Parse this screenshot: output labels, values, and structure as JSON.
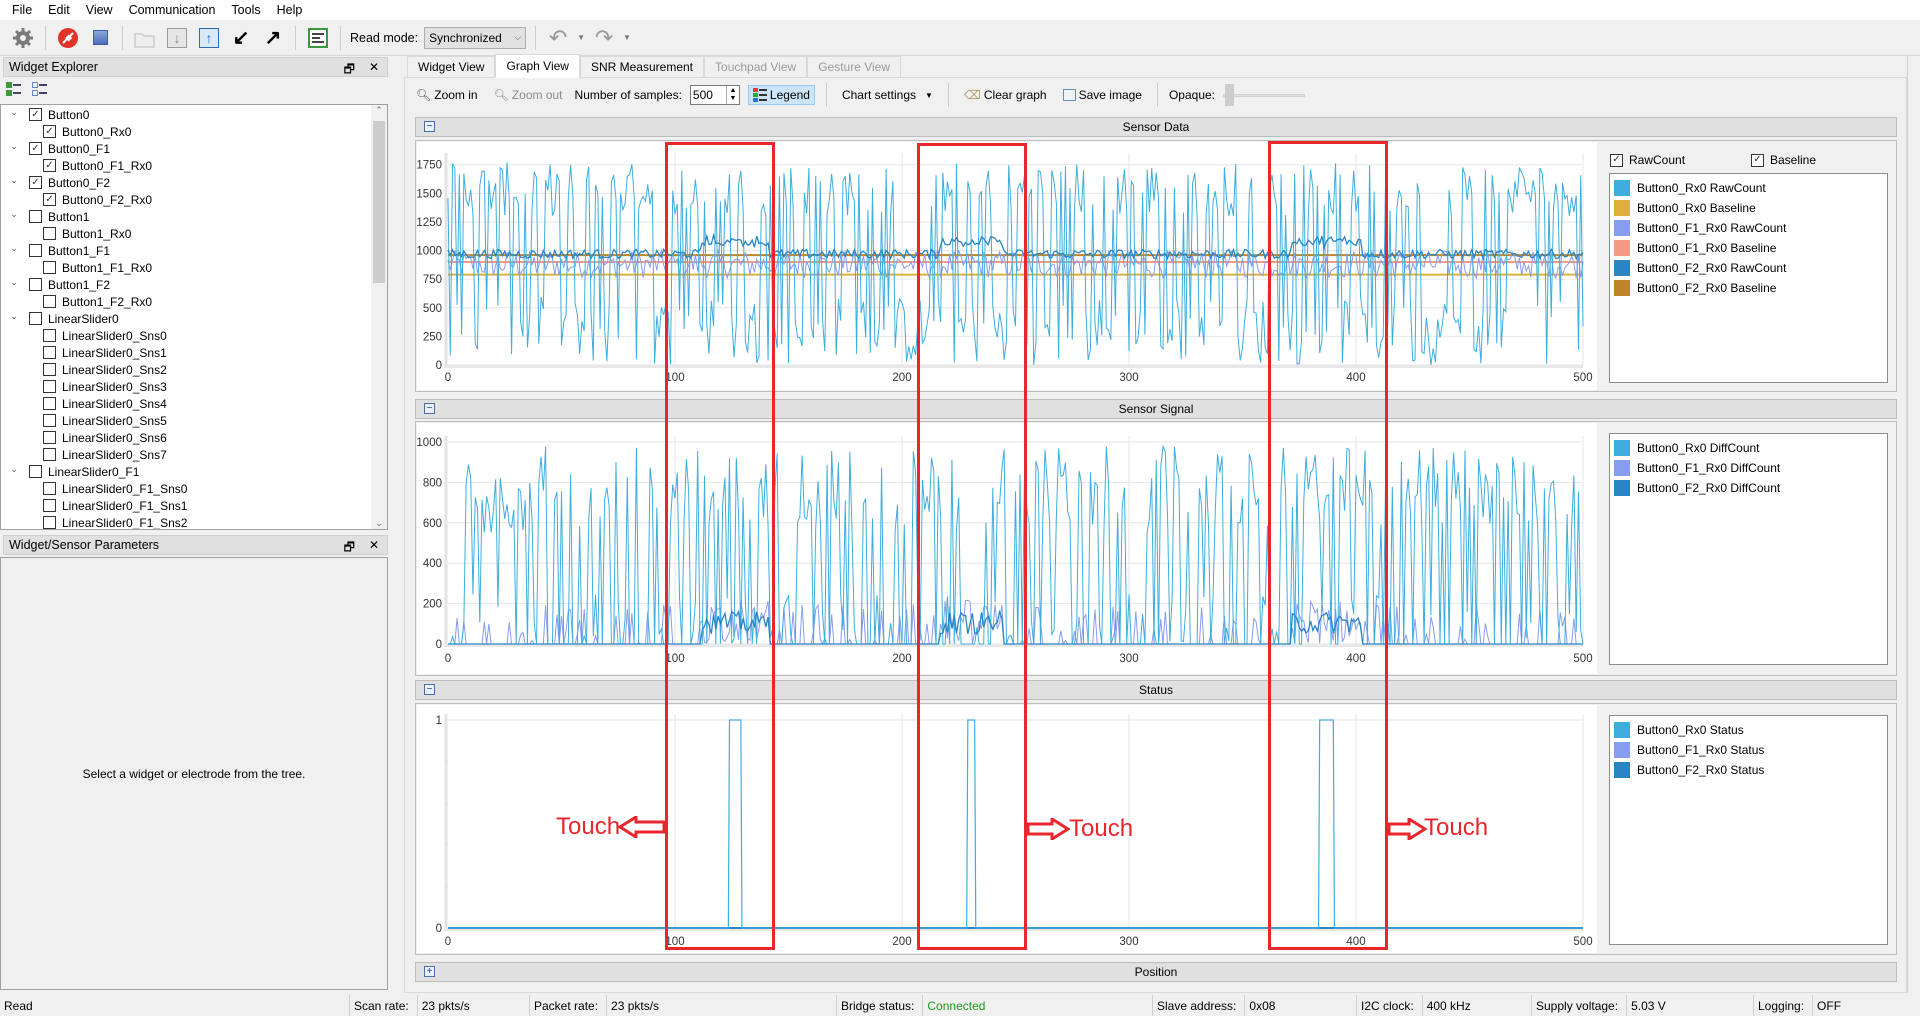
{
  "menu": [
    "File",
    "Edit",
    "View",
    "Communication",
    "Tools",
    "Help"
  ],
  "toolbar": {
    "icons": [
      "gear-icon",
      "disconnect-icon",
      "stop-icon",
      "open-folder-icon",
      "download-icon",
      "upload-icon",
      "import-icon",
      "export-icon",
      "log-icon"
    ],
    "read_mode_label": "Read mode:",
    "read_mode_value": "Synchronized",
    "undo": "undo-icon",
    "redo": "redo-icon"
  },
  "widget_explorer": {
    "title": "Widget Explorer",
    "tree": [
      {
        "label": "Button0",
        "level": 0,
        "checked": true
      },
      {
        "label": "Button0_Rx0",
        "level": 1,
        "checked": true
      },
      {
        "label": "Button0_F1",
        "level": 0,
        "checked": true
      },
      {
        "label": "Button0_F1_Rx0",
        "level": 1,
        "checked": true
      },
      {
        "label": "Button0_F2",
        "level": 0,
        "checked": true
      },
      {
        "label": "Button0_F2_Rx0",
        "level": 1,
        "checked": true
      },
      {
        "label": "Button1",
        "level": 0,
        "checked": false
      },
      {
        "label": "Button1_Rx0",
        "level": 1,
        "checked": false
      },
      {
        "label": "Button1_F1",
        "level": 0,
        "checked": false
      },
      {
        "label": "Button1_F1_Rx0",
        "level": 1,
        "checked": false
      },
      {
        "label": "Button1_F2",
        "level": 0,
        "checked": false
      },
      {
        "label": "Button1_F2_Rx0",
        "level": 1,
        "checked": false
      },
      {
        "label": "LinearSlider0",
        "level": 0,
        "checked": false
      },
      {
        "label": "LinearSlider0_Sns0",
        "level": 1,
        "checked": false
      },
      {
        "label": "LinearSlider0_Sns1",
        "level": 1,
        "checked": false
      },
      {
        "label": "LinearSlider0_Sns2",
        "level": 1,
        "checked": false
      },
      {
        "label": "LinearSlider0_Sns3",
        "level": 1,
        "checked": false
      },
      {
        "label": "LinearSlider0_Sns4",
        "level": 1,
        "checked": false
      },
      {
        "label": "LinearSlider0_Sns5",
        "level": 1,
        "checked": false
      },
      {
        "label": "LinearSlider0_Sns6",
        "level": 1,
        "checked": false
      },
      {
        "label": "LinearSlider0_Sns7",
        "level": 1,
        "checked": false
      },
      {
        "label": "LinearSlider0_F1",
        "level": 0,
        "checked": false
      },
      {
        "label": "LinearSlider0_F1_Sns0",
        "level": 1,
        "checked": false
      },
      {
        "label": "LinearSlider0_F1_Sns1",
        "level": 1,
        "checked": false
      },
      {
        "label": "LinearSlider0_F1_Sns2",
        "level": 1,
        "checked": false
      }
    ]
  },
  "params": {
    "title": "Widget/Sensor Parameters",
    "placeholder": "Select a widget or electrode from the tree."
  },
  "tabs": [
    {
      "label": "Widget View",
      "state": "normal"
    },
    {
      "label": "Graph View",
      "state": "active"
    },
    {
      "label": "SNR Measurement",
      "state": "normal"
    },
    {
      "label": "Touchpad View",
      "state": "disabled"
    },
    {
      "label": "Gesture View",
      "state": "disabled"
    }
  ],
  "graph_toolbar": {
    "zoom_in": "Zoom in",
    "zoom_out": "Zoom out",
    "samples_label": "Number of samples:",
    "samples_value": "500",
    "legend": "Legend",
    "chart_settings": "Chart settings",
    "clear_graph": "Clear graph",
    "save_image": "Save image",
    "opaque": "Opaque:"
  },
  "sections": {
    "sensor_data": "Sensor Data",
    "sensor_signal": "Sensor Signal",
    "status": "Status",
    "position": "Position"
  },
  "legend_toggles": {
    "rawcount": "RawCount",
    "baseline": "Baseline"
  },
  "annotations": {
    "touch": "Touch"
  },
  "colors": {
    "b0_rx0": "#3eaedc",
    "b0_rx0_baseline": "#ddb03c",
    "f1_rx0": "#879df0",
    "f1_rx0_baseline": "#f29c85",
    "f2_rx0": "#2a85c2",
    "f2_rx0_baseline": "#bf8528",
    "annotation": "#e8262d",
    "connected": "#1a9a1a"
  },
  "chart_data": [
    {
      "type": "line",
      "title": "Sensor Data",
      "xlim": [
        0,
        500
      ],
      "ylim": [
        0,
        1800
      ],
      "xticks": [
        0,
        100,
        200,
        300,
        400,
        500
      ],
      "yticks": [
        0,
        250,
        500,
        750,
        1000,
        1250,
        1500,
        1750
      ],
      "grid": true,
      "legend_position": "right",
      "series": [
        {
          "name": "Button0_Rx0 RawCount",
          "color_key": "b0_rx0",
          "pattern": "noisy square 0-1750, mean ~900"
        },
        {
          "name": "Button0_Rx0 Baseline",
          "color_key": "b0_rx0_baseline",
          "constant": 790
        },
        {
          "name": "Button0_F1_Rx0 RawCount",
          "color_key": "f1_rx0",
          "pattern": "noise 750-1000"
        },
        {
          "name": "Button0_F1_Rx0 Baseline",
          "color_key": "f1_rx0_baseline",
          "constant": 900
        },
        {
          "name": "Button0_F2_Rx0 RawCount",
          "color_key": "f2_rx0",
          "pattern": "noise 930-1010, bump ~1100 during touches"
        },
        {
          "name": "Button0_F2_Rx0 Baseline",
          "color_key": "f2_rx0_baseline",
          "constant": 960
        }
      ]
    },
    {
      "type": "line",
      "title": "Sensor Signal",
      "xlim": [
        0,
        500
      ],
      "ylim": [
        0,
        1000
      ],
      "xticks": [
        0,
        100,
        200,
        300,
        400,
        500
      ],
      "yticks": [
        0,
        200,
        400,
        600,
        800,
        1000
      ],
      "grid": true,
      "legend_position": "right",
      "series": [
        {
          "name": "Button0_Rx0 DiffCount",
          "color_key": "b0_rx0",
          "pattern": "noisy spikes 0-980"
        },
        {
          "name": "Button0_F1_Rx0 DiffCount",
          "color_key": "f1_rx0",
          "pattern": "small spikes 0-200"
        },
        {
          "name": "Button0_F2_Rx0 DiffCount",
          "color_key": "f2_rx0",
          "pattern": "near 0, ~150 during touches"
        }
      ]
    },
    {
      "type": "line",
      "title": "Status",
      "xlim": [
        0,
        500
      ],
      "ylim": [
        0,
        1
      ],
      "xticks": [
        0,
        100,
        200,
        300,
        400,
        500
      ],
      "yticks": [
        0,
        1
      ],
      "grid": true,
      "legend_position": "right",
      "series": [
        {
          "name": "Button0_Rx0 Status",
          "color_key": "b0_rx0",
          "pulses": [
            [
              124,
              129
            ],
            [
              229,
              232
            ],
            [
              384,
              390
            ]
          ]
        },
        {
          "name": "Button0_F1_Rx0 Status",
          "color_key": "f1_rx0",
          "pulses": []
        },
        {
          "name": "Button0_F2_Rx0 Status",
          "color_key": "f2_rx0",
          "pulses": []
        }
      ]
    }
  ],
  "statusbar": {
    "state": "Read",
    "scan_rate_label": "Scan rate:",
    "scan_rate": "23 pkts/s",
    "packet_rate_label": "Packet rate:",
    "packet_rate": "23 pkts/s",
    "bridge_label": "Bridge status:",
    "bridge": "Connected",
    "slave_label": "Slave address:",
    "slave": "0x08",
    "i2c_label": "I2C clock:",
    "i2c": "400 kHz",
    "voltage_label": "Supply voltage:",
    "voltage": "5.03 V",
    "logging_label": "Logging:",
    "logging": "OFF"
  }
}
